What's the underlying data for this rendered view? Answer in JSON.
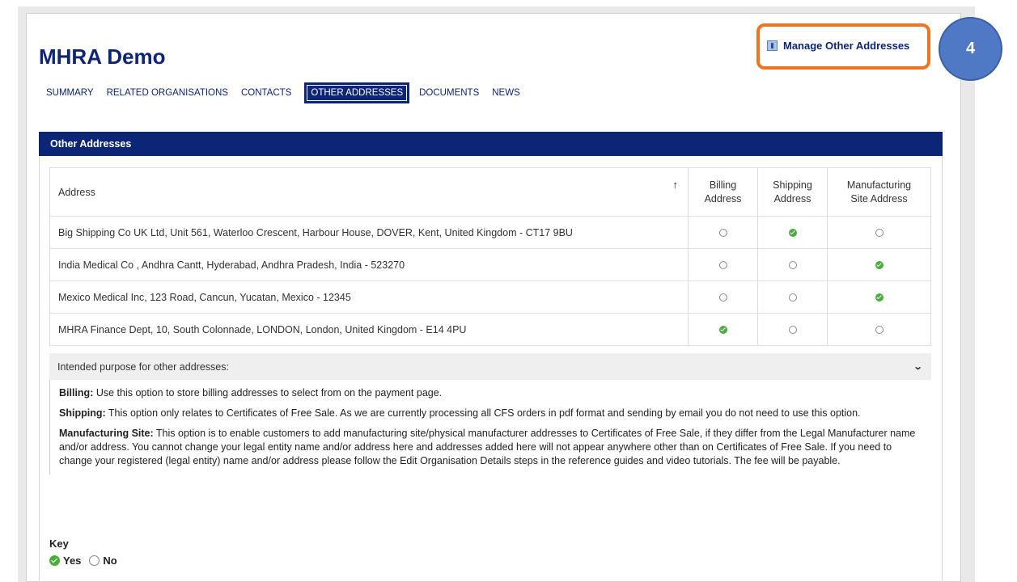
{
  "page": {
    "title": "MHRA Demo"
  },
  "actions": {
    "manage_addresses_label": "Manage Other Addresses"
  },
  "callout": {
    "step_number": "4"
  },
  "tabs": [
    {
      "label": "SUMMARY",
      "active": false
    },
    {
      "label": "RELATED ORGANISATIONS",
      "active": false
    },
    {
      "label": "CONTACTS",
      "active": false
    },
    {
      "label": "OTHER ADDRESSES",
      "active": true
    },
    {
      "label": "DOCUMENTS",
      "active": false
    },
    {
      "label": "NEWS",
      "active": false
    }
  ],
  "section": {
    "title": "Other Addresses"
  },
  "table": {
    "headers": {
      "address": "Address",
      "billing_line1": "Billing",
      "billing_line2": "Address",
      "shipping_line1": "Shipping",
      "shipping_line2": "Address",
      "manufacturing_line1": "Manufacturing",
      "manufacturing_line2": "Site Address"
    },
    "sort_icon": "sort-ascending-icon",
    "rows": [
      {
        "address": "Big Shipping Co UK Ltd, Unit 561, Waterloo Crescent, Harbour House, DOVER, Kent, United Kingdom - CT17 9BU",
        "billing": false,
        "shipping": true,
        "manufacturing": false
      },
      {
        "address": "India Medical Co , Andhra Cantt, Hyderabad, Andhra Pradesh, India - 523270",
        "billing": false,
        "shipping": false,
        "manufacturing": true
      },
      {
        "address": "Mexico Medical Inc, 123 Road, Cancun, Yucatan, Mexico - 12345",
        "billing": false,
        "shipping": false,
        "manufacturing": true
      },
      {
        "address": "MHRA Finance Dept, 10, South Colonnade, LONDON, London, United Kingdom - E14 4PU",
        "billing": true,
        "shipping": false,
        "manufacturing": false
      }
    ]
  },
  "purpose": {
    "heading": "Intended purpose for other addresses:",
    "billing_label": "Billing:",
    "billing_text": " Use this option to store billing addresses to select from on the payment page.",
    "shipping_label": "Shipping:",
    "shipping_text": " This option only relates to Certificates of Free Sale. As we are currently processing all CFS orders in pdf format and sending by email you do not need to use this option.",
    "manufacturing_label": "Manufacturing Site:",
    "manufacturing_text": " This option is to enable customers to add manufacturing site/physical manufacturer addresses to Certificates of Free Sale, if they differ from the Legal Manufacturer name and/or address. You cannot change your legal entity name and/or address here and addresses added here will not appear anywhere other than on Certificates of Free Sale. If you need to change your registered (legal entity) name and/or address please follow the Edit Organisation Details steps in the reference guides and video tutorials. The fee will be payable."
  },
  "key": {
    "title": "Key",
    "yes_label": "Yes",
    "no_label": "No"
  },
  "colors": {
    "brand_navy": "#0c2577",
    "check_green": "#4cad3f",
    "callout_orange": "#f0731d",
    "step_blue": "#4f79c5"
  }
}
